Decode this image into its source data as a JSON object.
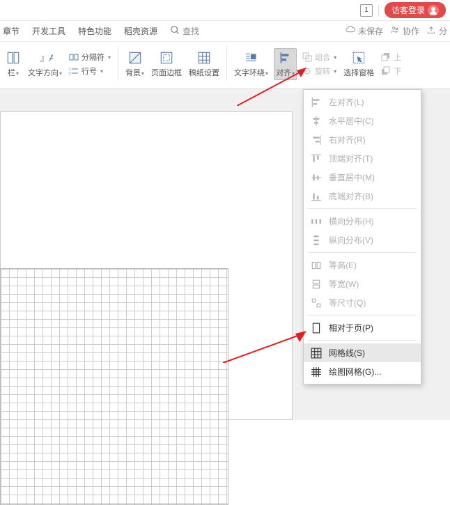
{
  "topbar": {
    "tab_number": "1",
    "login_label": "访客登录"
  },
  "tabs": {
    "items": [
      "章节",
      "开发工具",
      "特色功能",
      "稻壳资源"
    ],
    "search_placeholder": "查找"
  },
  "status": {
    "unsaved": "未保存",
    "collaborate": "协作",
    "share": "分"
  },
  "ribbon": {
    "column": {
      "label": "栏"
    },
    "text_direction": {
      "label": "文字方向"
    },
    "separator": {
      "label": "分隔符"
    },
    "line_number": {
      "label": "行号"
    },
    "background": {
      "label": "背景"
    },
    "page_border": {
      "label": "页面边框"
    },
    "manuscript": {
      "label": "稿纸设置"
    },
    "text_wrap": {
      "label": "文字环绕"
    },
    "align": {
      "label": "对齐"
    },
    "group": {
      "label": "组合"
    },
    "rotate": {
      "label": "旋转"
    },
    "select_pane": {
      "label": "选择窗格"
    },
    "up": {
      "label": "上"
    },
    "down": {
      "label": "下"
    }
  },
  "align_menu": {
    "items": [
      {
        "icon": "align-left",
        "label": "左对齐(L)",
        "enabled": false
      },
      {
        "icon": "align-center-h",
        "label": "水平居中(C)",
        "enabled": false
      },
      {
        "icon": "align-right",
        "label": "右对齐(R)",
        "enabled": false
      },
      {
        "icon": "align-top",
        "label": "顶端对齐(T)",
        "enabled": false
      },
      {
        "icon": "align-middle-v",
        "label": "垂直居中(M)",
        "enabled": false
      },
      {
        "icon": "align-bottom",
        "label": "底端对齐(B)",
        "enabled": false
      },
      {
        "type": "sep"
      },
      {
        "icon": "dist-h",
        "label": "横向分布(H)",
        "enabled": false
      },
      {
        "icon": "dist-v",
        "label": "纵向分布(V)",
        "enabled": false
      },
      {
        "type": "sep"
      },
      {
        "icon": "equal-h",
        "label": "等高(E)",
        "enabled": false
      },
      {
        "icon": "equal-w",
        "label": "等宽(W)",
        "enabled": false
      },
      {
        "icon": "equal-size",
        "label": "等尺寸(Q)",
        "enabled": false
      },
      {
        "type": "sep"
      },
      {
        "icon": "page",
        "label": "相对于页(P)",
        "enabled": true
      },
      {
        "type": "sep"
      },
      {
        "icon": "gridlines",
        "label": "网格线(S)",
        "enabled": true,
        "highlight": true
      },
      {
        "icon": "drawgrid",
        "label": "绘图网格(G)...",
        "enabled": true
      }
    ]
  }
}
